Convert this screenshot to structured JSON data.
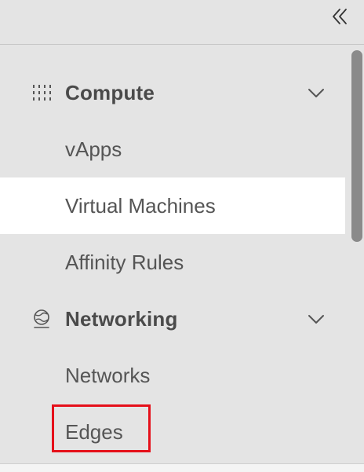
{
  "colors": {
    "background": "#e4e4e4",
    "active_item_bg": "#ffffff",
    "text": "#555555",
    "highlight_border": "#e5101a",
    "scroll_thumb": "#8a8a8a"
  },
  "top_bar": {
    "collapse_icon": "double-chevron-left-icon"
  },
  "sidebar": {
    "sections": [
      {
        "label": "Compute",
        "icon": "compute-grid-icon",
        "expanded": true,
        "items": [
          {
            "label": "vApps",
            "active": false
          },
          {
            "label": "Virtual Machines",
            "active": true
          },
          {
            "label": "Affinity Rules",
            "active": false
          }
        ]
      },
      {
        "label": "Networking",
        "icon": "networking-globe-icon",
        "expanded": true,
        "items": [
          {
            "label": "Networks",
            "active": false
          },
          {
            "label": "Edges",
            "active": false,
            "highlighted": true
          }
        ]
      }
    ]
  }
}
